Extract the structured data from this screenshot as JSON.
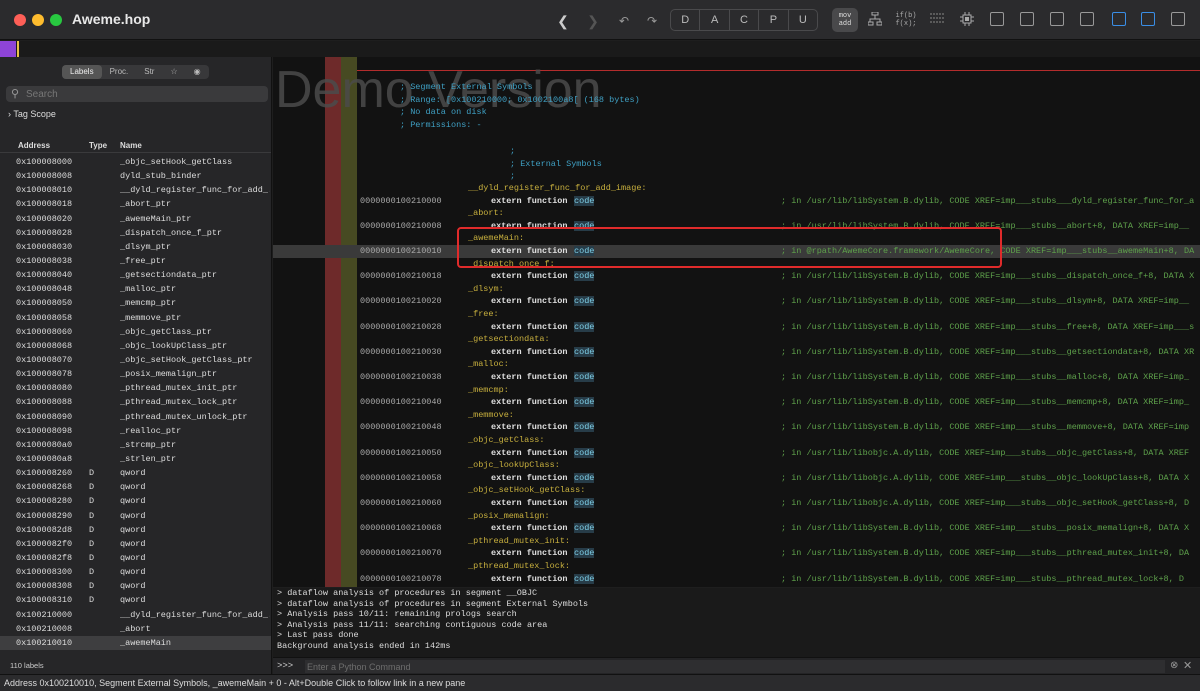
{
  "window": {
    "title": "Aweme.hop"
  },
  "toolbar": {
    "back_icon": "chevron-left-icon",
    "forward_icon": "chevron-right-icon",
    "undo_icon": "undo-icon",
    "redo_icon": "redo-icon",
    "segments": [
      "D",
      "A",
      "C",
      "P",
      "U"
    ],
    "mov_add": [
      "mov",
      "add"
    ],
    "if_b": [
      "if(b)",
      "f(x);"
    ]
  },
  "left_panel": {
    "tabs": [
      "Labels",
      "Proc.",
      "Str",
      "☆",
      "◉"
    ],
    "search_placeholder": "Search",
    "tag_scope": "Tag Scope",
    "columns": [
      "Address",
      "Type",
      "Name"
    ],
    "rows": [
      {
        "addr": "0x100008000",
        "type": "",
        "name": "_objc_setHook_getClass"
      },
      {
        "addr": "0x100008008",
        "type": "",
        "name": "dyld_stub_binder"
      },
      {
        "addr": "0x100008010",
        "type": "",
        "name": "__dyld_register_func_for_add_..."
      },
      {
        "addr": "0x100008018",
        "type": "",
        "name": "_abort_ptr"
      },
      {
        "addr": "0x100008020",
        "type": "",
        "name": "_awemeMain_ptr"
      },
      {
        "addr": "0x100008028",
        "type": "",
        "name": "_dispatch_once_f_ptr"
      },
      {
        "addr": "0x100008030",
        "type": "",
        "name": "_dlsym_ptr"
      },
      {
        "addr": "0x100008038",
        "type": "",
        "name": "_free_ptr"
      },
      {
        "addr": "0x100008040",
        "type": "",
        "name": "_getsectiondata_ptr"
      },
      {
        "addr": "0x100008048",
        "type": "",
        "name": "_malloc_ptr"
      },
      {
        "addr": "0x100008050",
        "type": "",
        "name": "_memcmp_ptr"
      },
      {
        "addr": "0x100008058",
        "type": "",
        "name": "_memmove_ptr"
      },
      {
        "addr": "0x100008060",
        "type": "",
        "name": "_objc_getClass_ptr"
      },
      {
        "addr": "0x100008068",
        "type": "",
        "name": "_objc_lookUpClass_ptr"
      },
      {
        "addr": "0x100008070",
        "type": "",
        "name": "_objc_setHook_getClass_ptr"
      },
      {
        "addr": "0x100008078",
        "type": "",
        "name": "_posix_memalign_ptr"
      },
      {
        "addr": "0x100008080",
        "type": "",
        "name": "_pthread_mutex_init_ptr"
      },
      {
        "addr": "0x100008088",
        "type": "",
        "name": "_pthread_mutex_lock_ptr"
      },
      {
        "addr": "0x100008090",
        "type": "",
        "name": "_pthread_mutex_unlock_ptr"
      },
      {
        "addr": "0x100008098",
        "type": "",
        "name": "_realloc_ptr"
      },
      {
        "addr": "0x1000080a0",
        "type": "",
        "name": "_strcmp_ptr"
      },
      {
        "addr": "0x1000080a8",
        "type": "",
        "name": "_strlen_ptr"
      },
      {
        "addr": "0x100008260",
        "type": "D",
        "name": "qword"
      },
      {
        "addr": "0x100008268",
        "type": "D",
        "name": "qword"
      },
      {
        "addr": "0x100008280",
        "type": "D",
        "name": "qword"
      },
      {
        "addr": "0x100008290",
        "type": "D",
        "name": "qword"
      },
      {
        "addr": "0x1000082d8",
        "type": "D",
        "name": "qword"
      },
      {
        "addr": "0x1000082f0",
        "type": "D",
        "name": "qword"
      },
      {
        "addr": "0x1000082f8",
        "type": "D",
        "name": "qword"
      },
      {
        "addr": "0x100008300",
        "type": "D",
        "name": "qword"
      },
      {
        "addr": "0x100008308",
        "type": "D",
        "name": "qword"
      },
      {
        "addr": "0x100008310",
        "type": "D",
        "name": "qword"
      },
      {
        "addr": "0x100210000",
        "type": "",
        "name": "__dyld_register_func_for_add_..."
      },
      {
        "addr": "0x100210008",
        "type": "",
        "name": "_abort"
      },
      {
        "addr": "0x100210010",
        "type": "",
        "name": "_awemeMain"
      }
    ],
    "count": "110 labels"
  },
  "code": {
    "watermark": "Demo Version",
    "header": [
      "; Segment External Symbols",
      "; Range: [0x100210000; 0x1002100a8[ (168 bytes)",
      "; No data on disk",
      "; Permissions:  -"
    ],
    "section": [
      ";",
      "; External Symbols",
      ";"
    ],
    "entries": [
      {
        "label": "__dyld_register_func_for_add_image:",
        "addr": "0000000100210000",
        "xref": "; in /usr/lib/libSystem.B.dylib, CODE XREF=imp___stubs___dyld_register_func_for_a"
      },
      {
        "label": "_abort:",
        "addr": "0000000100210008",
        "xref": "; in /usr/lib/libSystem.B.dylib, CODE XREF=imp___stubs__abort+8, DATA XREF=imp__"
      },
      {
        "label": "_awemeMain:",
        "addr": "0000000100210010",
        "xref": "; in @rpath/AwemeCore.framework/AwemeCore, CODE XREF=imp___stubs__awemeMain+8, DA"
      },
      {
        "label": "_dispatch_once_f:",
        "addr": "0000000100210018",
        "xref": "; in /usr/lib/libSystem.B.dylib, CODE XREF=imp___stubs__dispatch_once_f+8, DATA X"
      },
      {
        "label": "_dlsym:",
        "addr": "0000000100210020",
        "xref": "; in /usr/lib/libSystem.B.dylib, CODE XREF=imp___stubs__dlsym+8, DATA XREF=imp__"
      },
      {
        "label": "_free:",
        "addr": "0000000100210028",
        "xref": "; in /usr/lib/libSystem.B.dylib, CODE XREF=imp___stubs__free+8, DATA XREF=imp___s"
      },
      {
        "label": "_getsectiondata:",
        "addr": "0000000100210030",
        "xref": "; in /usr/lib/libSystem.B.dylib, CODE XREF=imp___stubs__getsectiondata+8, DATA XR"
      },
      {
        "label": "_malloc:",
        "addr": "0000000100210038",
        "xref": "; in /usr/lib/libSystem.B.dylib, CODE XREF=imp___stubs__malloc+8, DATA XREF=imp_"
      },
      {
        "label": "_memcmp:",
        "addr": "0000000100210040",
        "xref": "; in /usr/lib/libSystem.B.dylib, CODE XREF=imp___stubs__memcmp+8, DATA XREF=imp_"
      },
      {
        "label": "_memmove:",
        "addr": "0000000100210048",
        "xref": "; in /usr/lib/libSystem.B.dylib, CODE XREF=imp___stubs__memmove+8, DATA XREF=imp"
      },
      {
        "label": "_objc_getClass:",
        "addr": "0000000100210050",
        "xref": "; in /usr/lib/libobjc.A.dylib, CODE XREF=imp___stubs__objc_getClass+8, DATA XREF"
      },
      {
        "label": "_objc_lookUpClass:",
        "addr": "0000000100210058",
        "xref": "; in /usr/lib/libobjc.A.dylib, CODE XREF=imp___stubs__objc_lookUpClass+8, DATA X"
      },
      {
        "label": "_objc_setHook_getClass:",
        "addr": "0000000100210060",
        "xref": "; in /usr/lib/libobjc.A.dylib, CODE XREF=imp___stubs__objc_setHook_getClass+8, D"
      },
      {
        "label": "_posix_memalign:",
        "addr": "0000000100210068",
        "xref": "; in /usr/lib/libSystem.B.dylib, CODE XREF=imp___stubs__posix_memalign+8, DATA X"
      },
      {
        "label": "_pthread_mutex_init:",
        "addr": "0000000100210070",
        "xref": "; in /usr/lib/libSystem.B.dylib, CODE XREF=imp___stubs__pthread_mutex_init+8, DA"
      },
      {
        "label": "_pthread_mutex_lock:",
        "addr": "0000000100210078",
        "xref": "; in /usr/lib/libSystem.B.dylib, CODE XREF=imp___stubs__pthread_mutex_lock+8, D"
      }
    ],
    "extern_kw": "extern function",
    "code_kw": "code"
  },
  "console": {
    "lines": [
      "> dataflow analysis of procedures in segment __OBJC",
      "> dataflow analysis of procedures in segment External Symbols",
      "> Analysis pass 10/11: remaining prologs search",
      "> Analysis pass 11/11: searching contiguous code area",
      "> Last pass done",
      "Background analysis ended in 142ms"
    ],
    "prompt": ">>>",
    "placeholder": "Enter a Python Command"
  },
  "status": "Address 0x100210010, Segment External Symbols, _awemeMain + 0 - Alt+Double Click to follow link in a new pane",
  "colors": {
    "background": "#121212",
    "label": "#c8b03e",
    "comment": "#3fa0c4",
    "xref": "#5ea14b",
    "highlight_box": "#e02b2b",
    "gutter_red": "#6e2a2a",
    "gutter_olive": "#474a22",
    "nav_purple": "#8e44d8"
  }
}
